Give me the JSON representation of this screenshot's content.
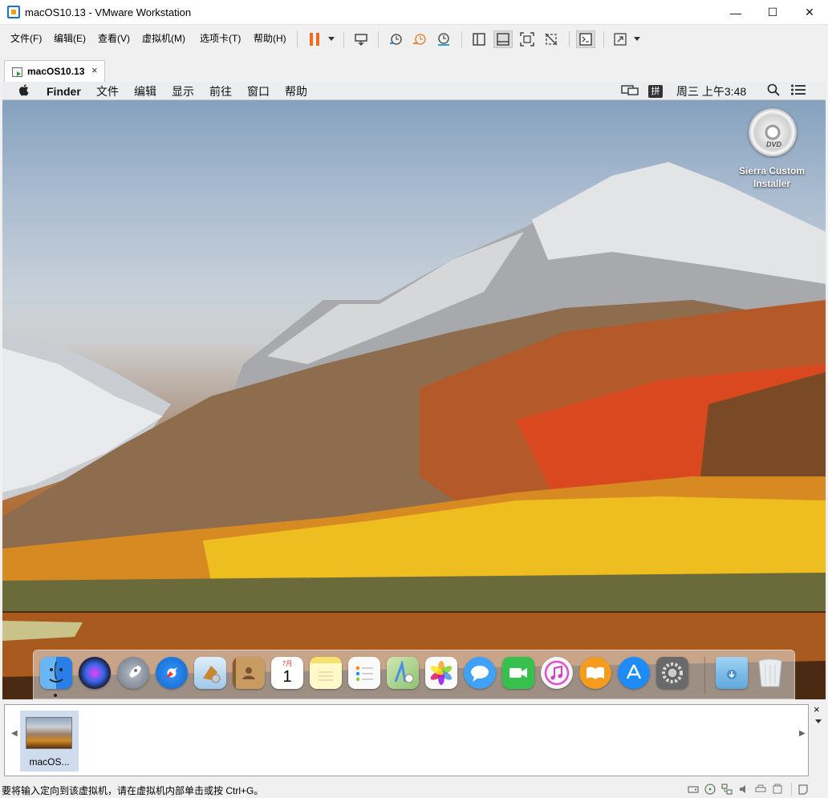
{
  "window": {
    "title": "macOS10.13 - VMware Workstation",
    "minimize": "—",
    "maximize": "☐",
    "close": "✕"
  },
  "menu": [
    "文件(F)",
    "编辑(E)",
    "查看(V)",
    "虚拟机(M)",
    "选项卡(T)",
    "帮助(H)"
  ],
  "toolbar": {
    "icons": [
      "pause-icon",
      "send-keys-icon",
      "snapshot-icon",
      "revert-snapshot-icon",
      "snapshot-manager-icon",
      "library-icon",
      "thumbnail-bar-icon",
      "fullscreen-icon",
      "unity-icon",
      "console-icon",
      "stretch-icon"
    ],
    "accent": "#f26b1d"
  },
  "tab": {
    "label": "macOS10.13",
    "close": "×"
  },
  "guest": {
    "menubar": {
      "apple": "",
      "items": [
        "Finder",
        "文件",
        "编辑",
        "显示",
        "前往",
        "窗口",
        "帮助"
      ],
      "input_method": "拼",
      "clock": "周三 上午3:48"
    },
    "desktop_icon": {
      "label": "Sierra Custom Installer",
      "disc_text": "DVD"
    },
    "dock": [
      {
        "name": "finder",
        "color": "#3d8df0"
      },
      {
        "name": "siri",
        "color": "#2c2c54"
      },
      {
        "name": "launchpad",
        "color": "#8f98a6"
      },
      {
        "name": "safari",
        "color": "#1e7ff0"
      },
      {
        "name": "mail",
        "color": "#7ab6e8"
      },
      {
        "name": "contacts",
        "color": "#b07a45"
      },
      {
        "name": "calendar",
        "color": "#ffffff"
      },
      {
        "name": "notes",
        "color": "#f9e478"
      },
      {
        "name": "reminders",
        "color": "#f5f5f5"
      },
      {
        "name": "maps",
        "color": "#79c26b"
      },
      {
        "name": "photos",
        "color": "#f5f5f5"
      },
      {
        "name": "messages",
        "color": "#3fa2f6"
      },
      {
        "name": "facetime",
        "color": "#38c04f"
      },
      {
        "name": "itunes",
        "color": "#f4f4f4"
      },
      {
        "name": "ibooks",
        "color": "#f59b1e"
      },
      {
        "name": "app-store",
        "color": "#1e8cf6"
      },
      {
        "name": "system-preferences",
        "color": "#8a8a8a"
      }
    ],
    "calendar_month": "7月",
    "calendar_day": "1",
    "downloads_color": "#6fb0e0",
    "trash_color": "#e8ecef"
  },
  "thumbnail": {
    "label": "macOS...",
    "close": "×"
  },
  "status": {
    "text": "要将输入定向到该虚拟机，请在虚拟机内部单击或按 Ctrl+G。"
  }
}
